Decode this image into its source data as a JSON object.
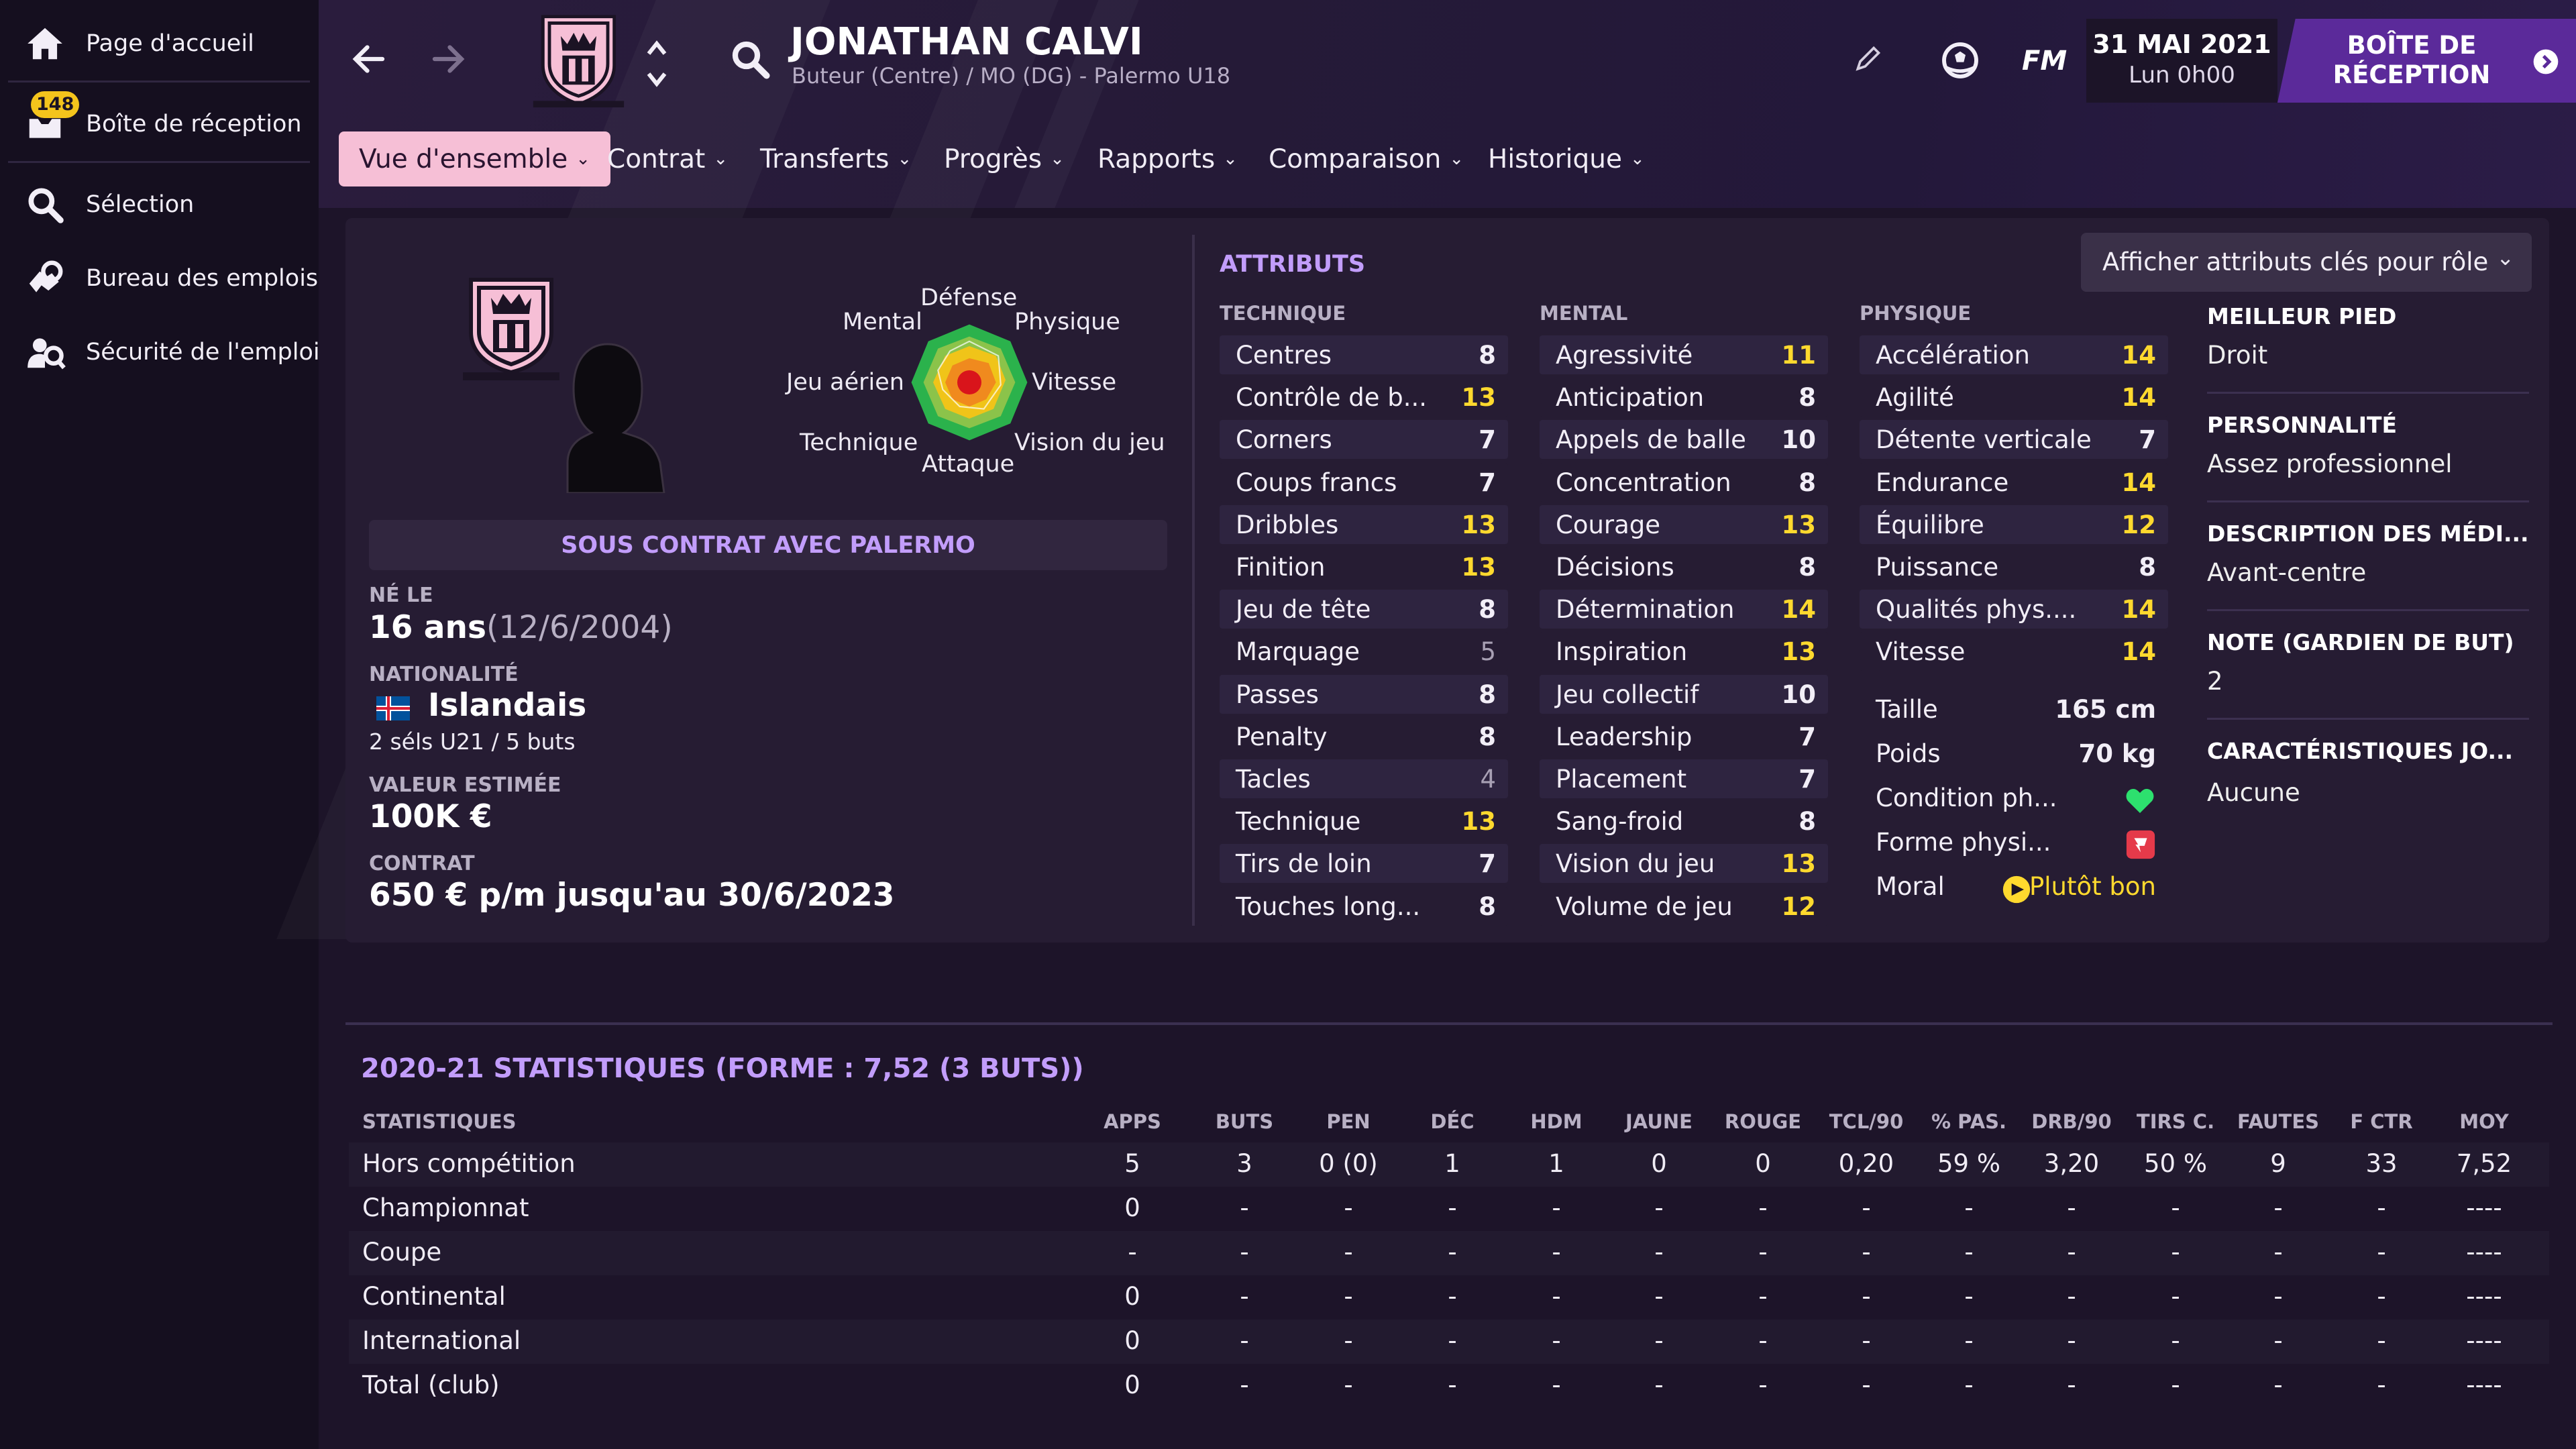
{
  "sidebar": {
    "items": [
      {
        "label": "Page d'accueil",
        "icon": "home-icon"
      },
      {
        "label": "Boîte de réception",
        "icon": "inbox-icon",
        "badge": "148"
      },
      {
        "label": "Sélection",
        "icon": "search-icon"
      },
      {
        "label": "Bureau des emplois",
        "icon": "job-search-icon"
      },
      {
        "label": "Sécurité de l'emploi",
        "icon": "job-security-icon"
      }
    ]
  },
  "header": {
    "player_name": "JONATHAN CALVI",
    "player_role": "Buteur (Centre) / MO (DG) - Palermo U18",
    "fm_label": "FM",
    "date": "31 MAI 2021",
    "time": "Lun 0h00",
    "inbox_button": "BOÎTE DE RÉCEPTION"
  },
  "tabs": [
    {
      "label": "Vue d'ensemble"
    },
    {
      "label": "Contrat"
    },
    {
      "label": "Transferts"
    },
    {
      "label": "Progrès"
    },
    {
      "label": "Rapports"
    },
    {
      "label": "Comparaison"
    },
    {
      "label": "Historique"
    }
  ],
  "profile": {
    "radar_labels": {
      "top": "Défense",
      "top_left": "Mental",
      "top_right": "Physique",
      "left": "Jeu aérien",
      "right": "Vitesse",
      "bottom_left": "Technique",
      "bottom_right": "Vision du jeu",
      "bottom": "Attaque"
    },
    "contract_banner": "SOUS CONTRAT AVEC PALERMO",
    "born_label": "NÉ LE",
    "age": "16 ans",
    "birth_date": "(12/6/2004)",
    "nationality_label": "NATIONALITÉ",
    "nationality": "Islandais",
    "caps": "2 séls U21 / 5 buts",
    "value_label": "VALEUR ESTIMÉE",
    "value": "100K €",
    "contract_label": "CONTRAT",
    "contract": "650 € p/m jusqu'au 30/6/2023"
  },
  "attributes": {
    "title": "ATTRIBUTS",
    "role_dropdown": "Afficher attributs clés pour rôle",
    "technique_title": "TECHNIQUE",
    "technique": [
      {
        "name": "Centres",
        "value": "8",
        "hl": ""
      },
      {
        "name": "Contrôle de b...",
        "value": "13",
        "hl": "y"
      },
      {
        "name": "Corners",
        "value": "7",
        "hl": ""
      },
      {
        "name": "Coups francs",
        "value": "7",
        "hl": ""
      },
      {
        "name": "Dribbles",
        "value": "13",
        "hl": "y"
      },
      {
        "name": "Finition",
        "value": "13",
        "hl": "y"
      },
      {
        "name": "Jeu de tête",
        "value": "8",
        "hl": ""
      },
      {
        "name": "Marquage",
        "value": "5",
        "hl": "g"
      },
      {
        "name": "Passes",
        "value": "8",
        "hl": ""
      },
      {
        "name": "Penalty",
        "value": "8",
        "hl": ""
      },
      {
        "name": "Tacles",
        "value": "4",
        "hl": "g"
      },
      {
        "name": "Technique",
        "value": "13",
        "hl": "y"
      },
      {
        "name": "Tirs de loin",
        "value": "7",
        "hl": ""
      },
      {
        "name": "Touches long...",
        "value": "8",
        "hl": ""
      }
    ],
    "mental_title": "MENTAL",
    "mental": [
      {
        "name": "Agressivité",
        "value": "11",
        "hl": "y"
      },
      {
        "name": "Anticipation",
        "value": "8",
        "hl": ""
      },
      {
        "name": "Appels de balle",
        "value": "10",
        "hl": ""
      },
      {
        "name": "Concentration",
        "value": "8",
        "hl": ""
      },
      {
        "name": "Courage",
        "value": "13",
        "hl": "y"
      },
      {
        "name": "Décisions",
        "value": "8",
        "hl": ""
      },
      {
        "name": "Détermination",
        "value": "14",
        "hl": "y"
      },
      {
        "name": "Inspiration",
        "value": "13",
        "hl": "y"
      },
      {
        "name": "Jeu collectif",
        "value": "10",
        "hl": ""
      },
      {
        "name": "Leadership",
        "value": "7",
        "hl": ""
      },
      {
        "name": "Placement",
        "value": "7",
        "hl": ""
      },
      {
        "name": "Sang-froid",
        "value": "8",
        "hl": ""
      },
      {
        "name": "Vision du jeu",
        "value": "13",
        "hl": "y"
      },
      {
        "name": "Volume de jeu",
        "value": "12",
        "hl": "y"
      }
    ],
    "physique_title": "PHYSIQUE",
    "physique": [
      {
        "name": "Accélération",
        "value": "14",
        "hl": "y"
      },
      {
        "name": "Agilité",
        "value": "14",
        "hl": "y"
      },
      {
        "name": "Détente verticale",
        "value": "7",
        "hl": ""
      },
      {
        "name": "Endurance",
        "value": "14",
        "hl": "y"
      },
      {
        "name": "Équilibre",
        "value": "12",
        "hl": "y"
      },
      {
        "name": "Puissance",
        "value": "8",
        "hl": ""
      },
      {
        "name": "Qualités phys....",
        "value": "14",
        "hl": "y"
      },
      {
        "name": "Vitesse",
        "value": "14",
        "hl": "y"
      }
    ],
    "height_label": "Taille",
    "height": "165 cm",
    "weight_label": "Poids",
    "weight": "70 kg",
    "condition_label": "Condition ph...",
    "form_label": "Forme physi...",
    "morale_label": "Moral",
    "morale": "Plutôt bon"
  },
  "right_info": {
    "foot_label": "MEILLEUR PIED",
    "foot": "Droit",
    "personality_label": "PERSONNALITÉ",
    "personality": "Assez professionnel",
    "media_label": "DESCRIPTION DES MÉDI...",
    "media": "Avant-centre",
    "gk_label": "NOTE (GARDIEN DE BUT)",
    "gk": "2",
    "traits_label": "CARACTÉRISTIQUES JO...",
    "traits": "Aucune"
  },
  "stats": {
    "title": "2020-21 STATISTIQUES (FORME : 7,52 (3 BUTS))",
    "row_header": "STATISTIQUES",
    "columns": [
      "APPS",
      "BUTS",
      "PEN",
      "DÉC",
      "HDM",
      "JAUNE",
      "ROUGE",
      "TCL/90",
      "% PAS.",
      "DRB/90",
      "TIRS C.",
      "FAUTES",
      "F CTR",
      "MOY"
    ],
    "rows": [
      {
        "label": "Hors compétition",
        "values": [
          "5",
          "3",
          "0 (0)",
          "1",
          "1",
          "0",
          "0",
          "0,20",
          "59 %",
          "3,20",
          "50 %",
          "9",
          "33",
          "7,52"
        ]
      },
      {
        "label": "Championnat",
        "values": [
          "0",
          "-",
          "-",
          "-",
          "-",
          "-",
          "-",
          "-",
          "-",
          "-",
          "-",
          "-",
          "-",
          "----"
        ]
      },
      {
        "label": "Coupe",
        "values": [
          "-",
          "-",
          "-",
          "-",
          "-",
          "-",
          "-",
          "-",
          "-",
          "-",
          "-",
          "-",
          "-",
          "----"
        ]
      },
      {
        "label": "Continental",
        "values": [
          "0",
          "-",
          "-",
          "-",
          "-",
          "-",
          "-",
          "-",
          "-",
          "-",
          "-",
          "-",
          "-",
          "----"
        ]
      },
      {
        "label": "International",
        "values": [
          "0",
          "-",
          "-",
          "-",
          "-",
          "-",
          "-",
          "-",
          "-",
          "-",
          "-",
          "-",
          "-",
          "----"
        ]
      },
      {
        "label": "Total (club)",
        "values": [
          "0",
          "-",
          "-",
          "-",
          "-",
          "-",
          "-",
          "-",
          "-",
          "-",
          "-",
          "-",
          "-",
          "----"
        ]
      }
    ]
  },
  "colors": {
    "accent_purple": "#c29dfb",
    "highlight_yellow": "#ffd92e",
    "tab_active": "#f6bfd6",
    "inbox_button": "#5b2a9a"
  }
}
